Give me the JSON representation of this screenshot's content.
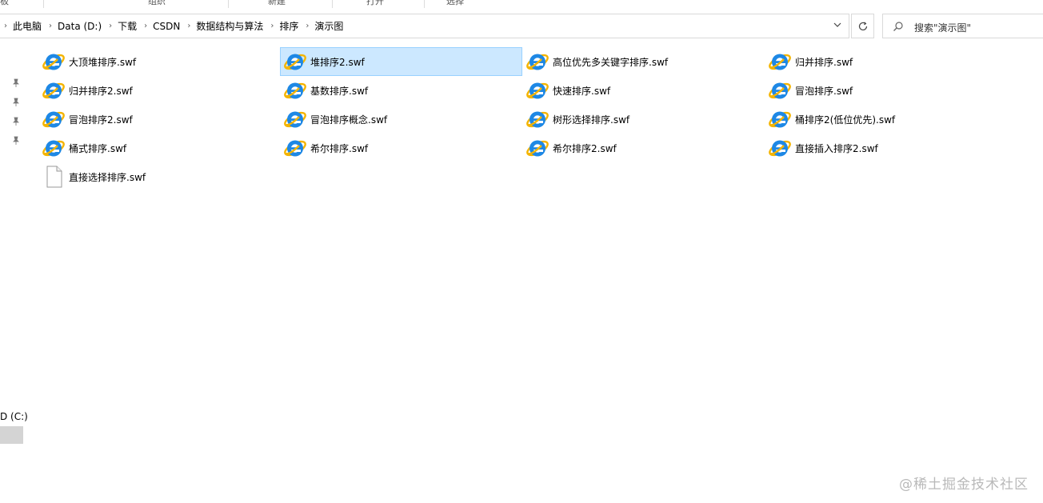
{
  "ribbon": {
    "groups": [
      "板",
      "组织",
      "新建",
      "打开",
      "选择"
    ]
  },
  "address_bar": {
    "breadcrumbs": [
      "此电脑",
      "Data (D:)",
      "下载",
      "CSDN",
      "数据结构与算法",
      "排序",
      "演示图"
    ]
  },
  "search": {
    "placeholder": "搜索\"演示图\""
  },
  "nav": {
    "drive_label": "D (C:)"
  },
  "files": [
    {
      "name": "大顶堆排序.swf",
      "icon": "ie-icon",
      "selected": false
    },
    {
      "name": "堆排序2.swf",
      "icon": "ie-icon",
      "selected": true
    },
    {
      "name": "高位优先多关键字排序.swf",
      "icon": "ie-icon",
      "selected": false
    },
    {
      "name": "归并排序.swf",
      "icon": "ie-icon",
      "selected": false
    },
    {
      "name": "归并排序2.swf",
      "icon": "ie-icon",
      "selected": false
    },
    {
      "name": "基数排序.swf",
      "icon": "ie-icon",
      "selected": false
    },
    {
      "name": "快速排序.swf",
      "icon": "ie-icon",
      "selected": false
    },
    {
      "name": "冒泡排序.swf",
      "icon": "ie-icon",
      "selected": false
    },
    {
      "name": "冒泡排序2.swf",
      "icon": "ie-icon",
      "selected": false
    },
    {
      "name": "冒泡排序概念.swf",
      "icon": "ie-icon",
      "selected": false
    },
    {
      "name": "树形选择排序.swf",
      "icon": "ie-icon",
      "selected": false
    },
    {
      "name": "桶排序2(低位优先).swf",
      "icon": "ie-icon",
      "selected": false
    },
    {
      "name": "桶式排序.swf",
      "icon": "ie-icon",
      "selected": false
    },
    {
      "name": "希尔排序.swf",
      "icon": "ie-icon",
      "selected": false
    },
    {
      "name": "希尔排序2.swf",
      "icon": "ie-icon",
      "selected": false
    },
    {
      "name": "直接插入排序2.swf",
      "icon": "ie-icon",
      "selected": false
    },
    {
      "name": "直接选择排序.swf",
      "icon": "blank-file-icon",
      "selected": false
    }
  ],
  "watermark": "@稀土掘金技术社区",
  "colors": {
    "selection_bg": "#cce8ff",
    "selection_border": "#99d1ff",
    "ie_blue": "#1e88e5",
    "ie_ring": "#f4b400"
  }
}
